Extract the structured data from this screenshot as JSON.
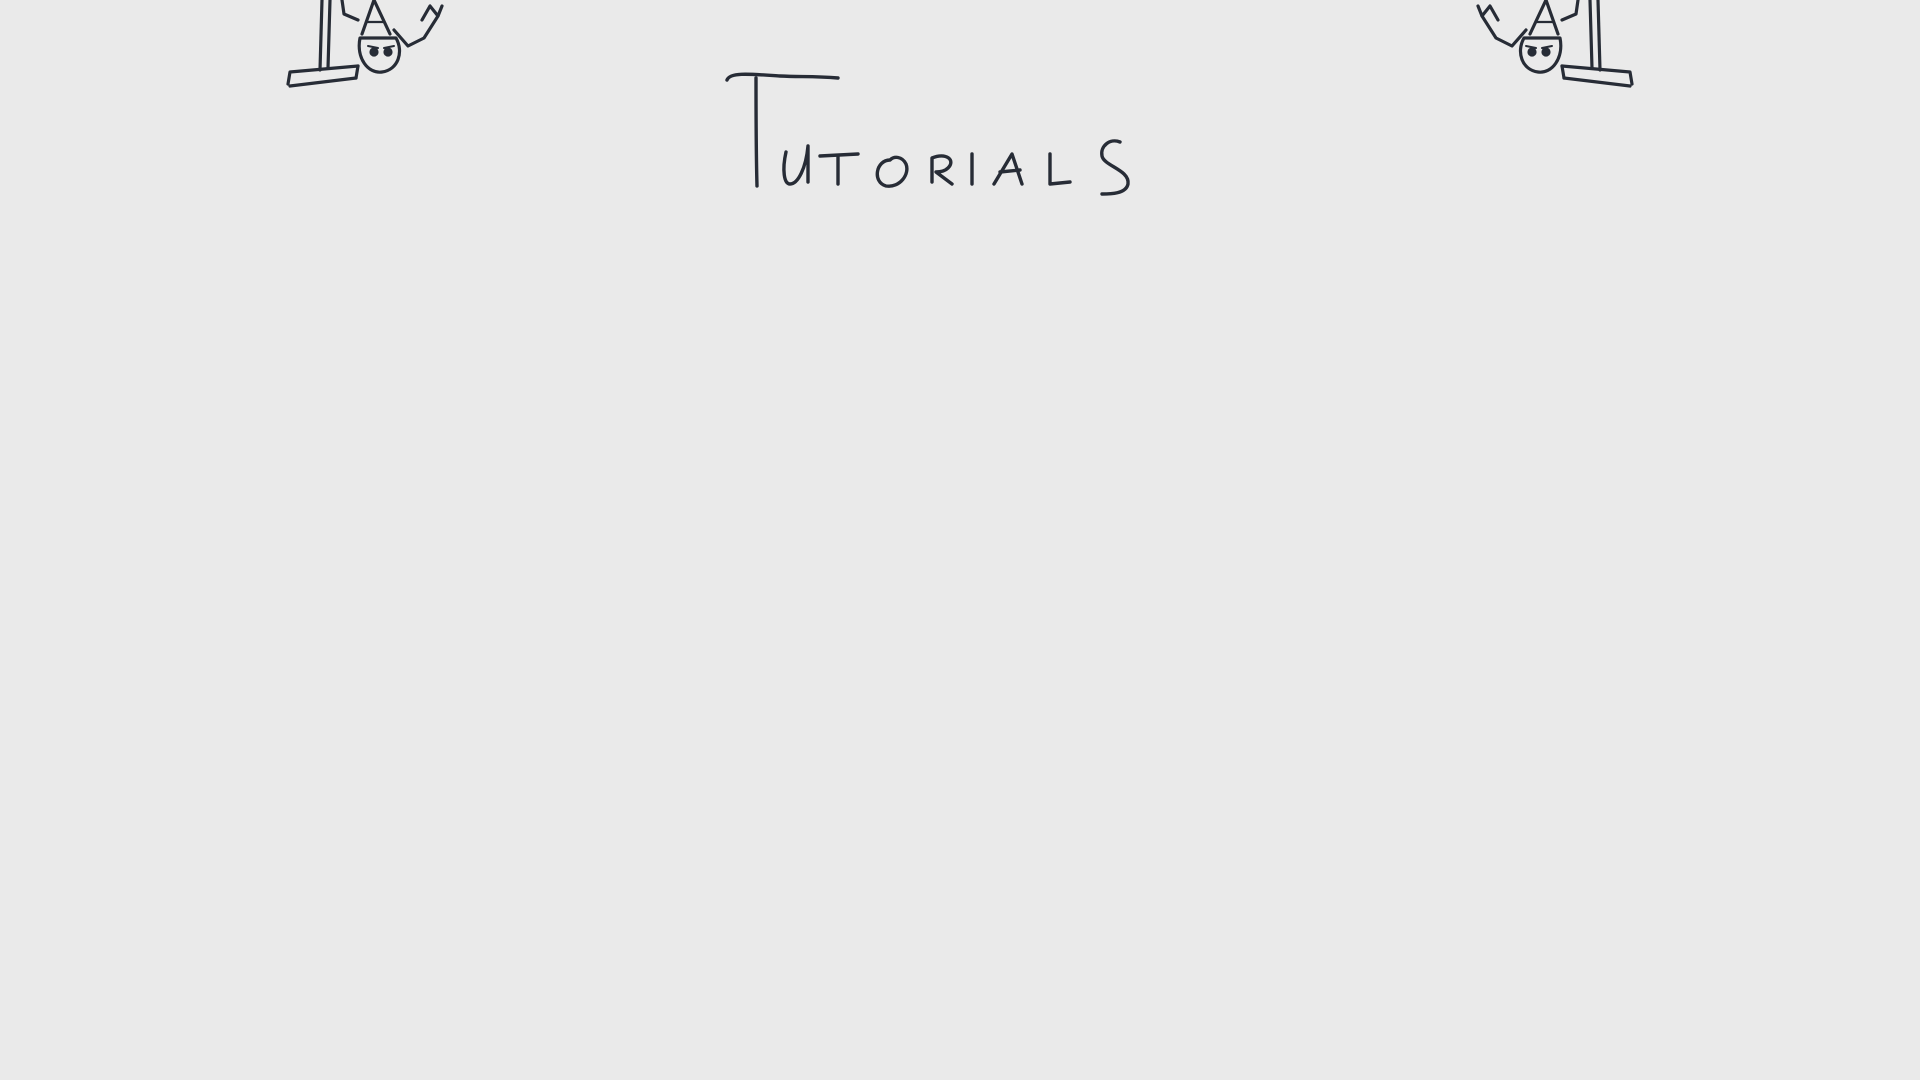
{
  "screen": {
    "title": "Tutorials",
    "background_color": "#eaeaea",
    "ink_color": "#272c36"
  },
  "decorations": {
    "left_character": "hanging-gnome-icon",
    "right_character": "hanging-gnome-icon"
  }
}
